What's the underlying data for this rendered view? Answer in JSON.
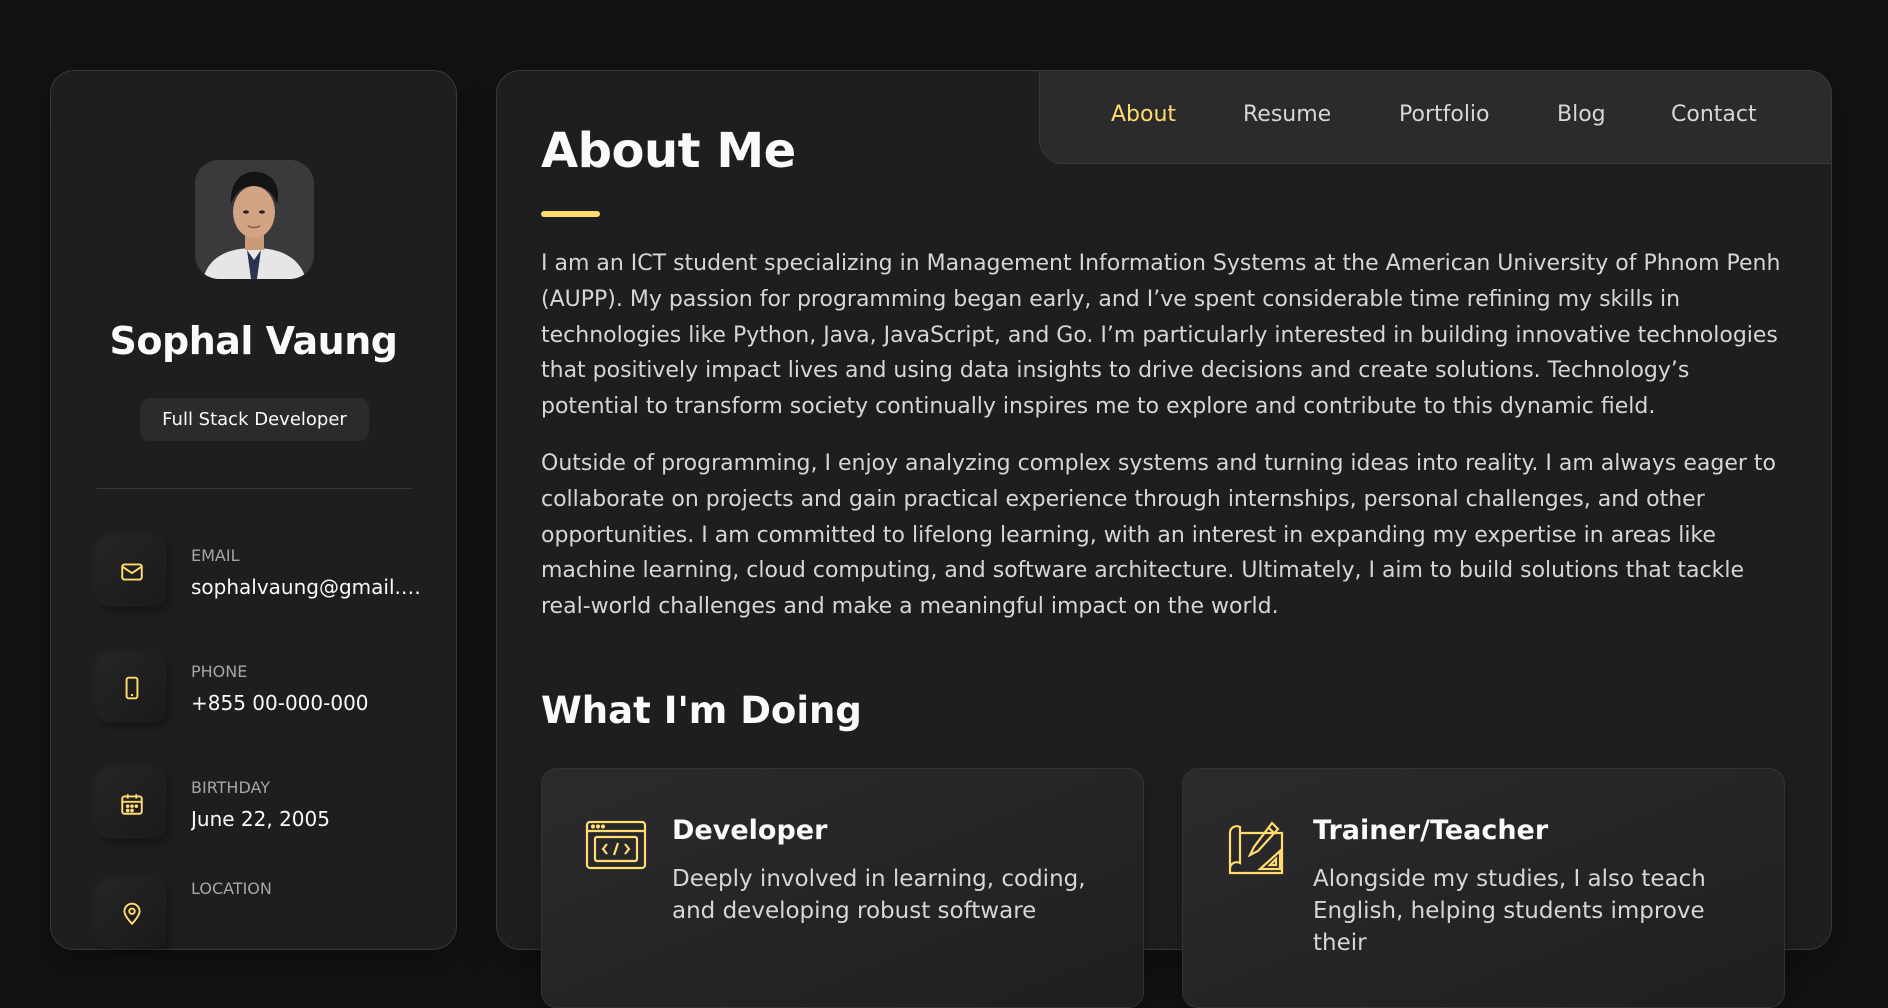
{
  "colors": {
    "accent": "#ffdb70",
    "background": "#121212",
    "card": "#1e1e1f",
    "text": "#fafafa",
    "muted": "#d6d6d6"
  },
  "sidebar": {
    "name": "Sophal Vaung",
    "title": "Full Stack Developer",
    "contacts": [
      {
        "icon": "mail-icon",
        "label": "Email",
        "value": "sophalvaung@gmail.com"
      },
      {
        "icon": "phone-icon",
        "label": "Phone",
        "value": "+855 00-000-000"
      },
      {
        "icon": "calendar-icon",
        "label": "Birthday",
        "value": "June 22, 2005"
      },
      {
        "icon": "location-icon",
        "label": "Location",
        "value": ""
      }
    ]
  },
  "nav": {
    "items": [
      "About",
      "Resume",
      "Portfolio",
      "Blog",
      "Contact"
    ],
    "active": "About"
  },
  "about": {
    "title": "About Me",
    "paragraphs": [
      "I am an ICT student specializing in Management Information Systems at the American University of Phnom Penh (AUPP). My passion for programming began early, and I’ve spent considerable time refining my skills in technologies like Python, Java, JavaScript, and Go. I’m particularly interested in building innovative technologies that positively impact lives and using data insights to drive decisions and create solutions. Technology’s potential to transform society continually inspires me to explore and contribute to this dynamic field.",
      "Outside of programming, I enjoy analyzing complex systems and turning ideas into reality. I am always eager to collaborate on projects and gain practical experience through internships, personal challenges, and other opportunities. I am committed to lifelong learning, with an interest in expanding my expertise in areas like machine learning, cloud computing, and software architecture. Ultimately, I aim to build solutions that tackle real-world challenges and make a meaningful impact on the world."
    ],
    "services_title": "What I'm Doing",
    "services": [
      {
        "icon": "code-window-icon",
        "title": "Developer",
        "text": "Deeply involved in learning, coding, and developing robust software"
      },
      {
        "icon": "drafting-tools-icon",
        "title": "Trainer/Teacher",
        "text": "Alongside my studies, I also teach English, helping students improve their"
      }
    ]
  }
}
